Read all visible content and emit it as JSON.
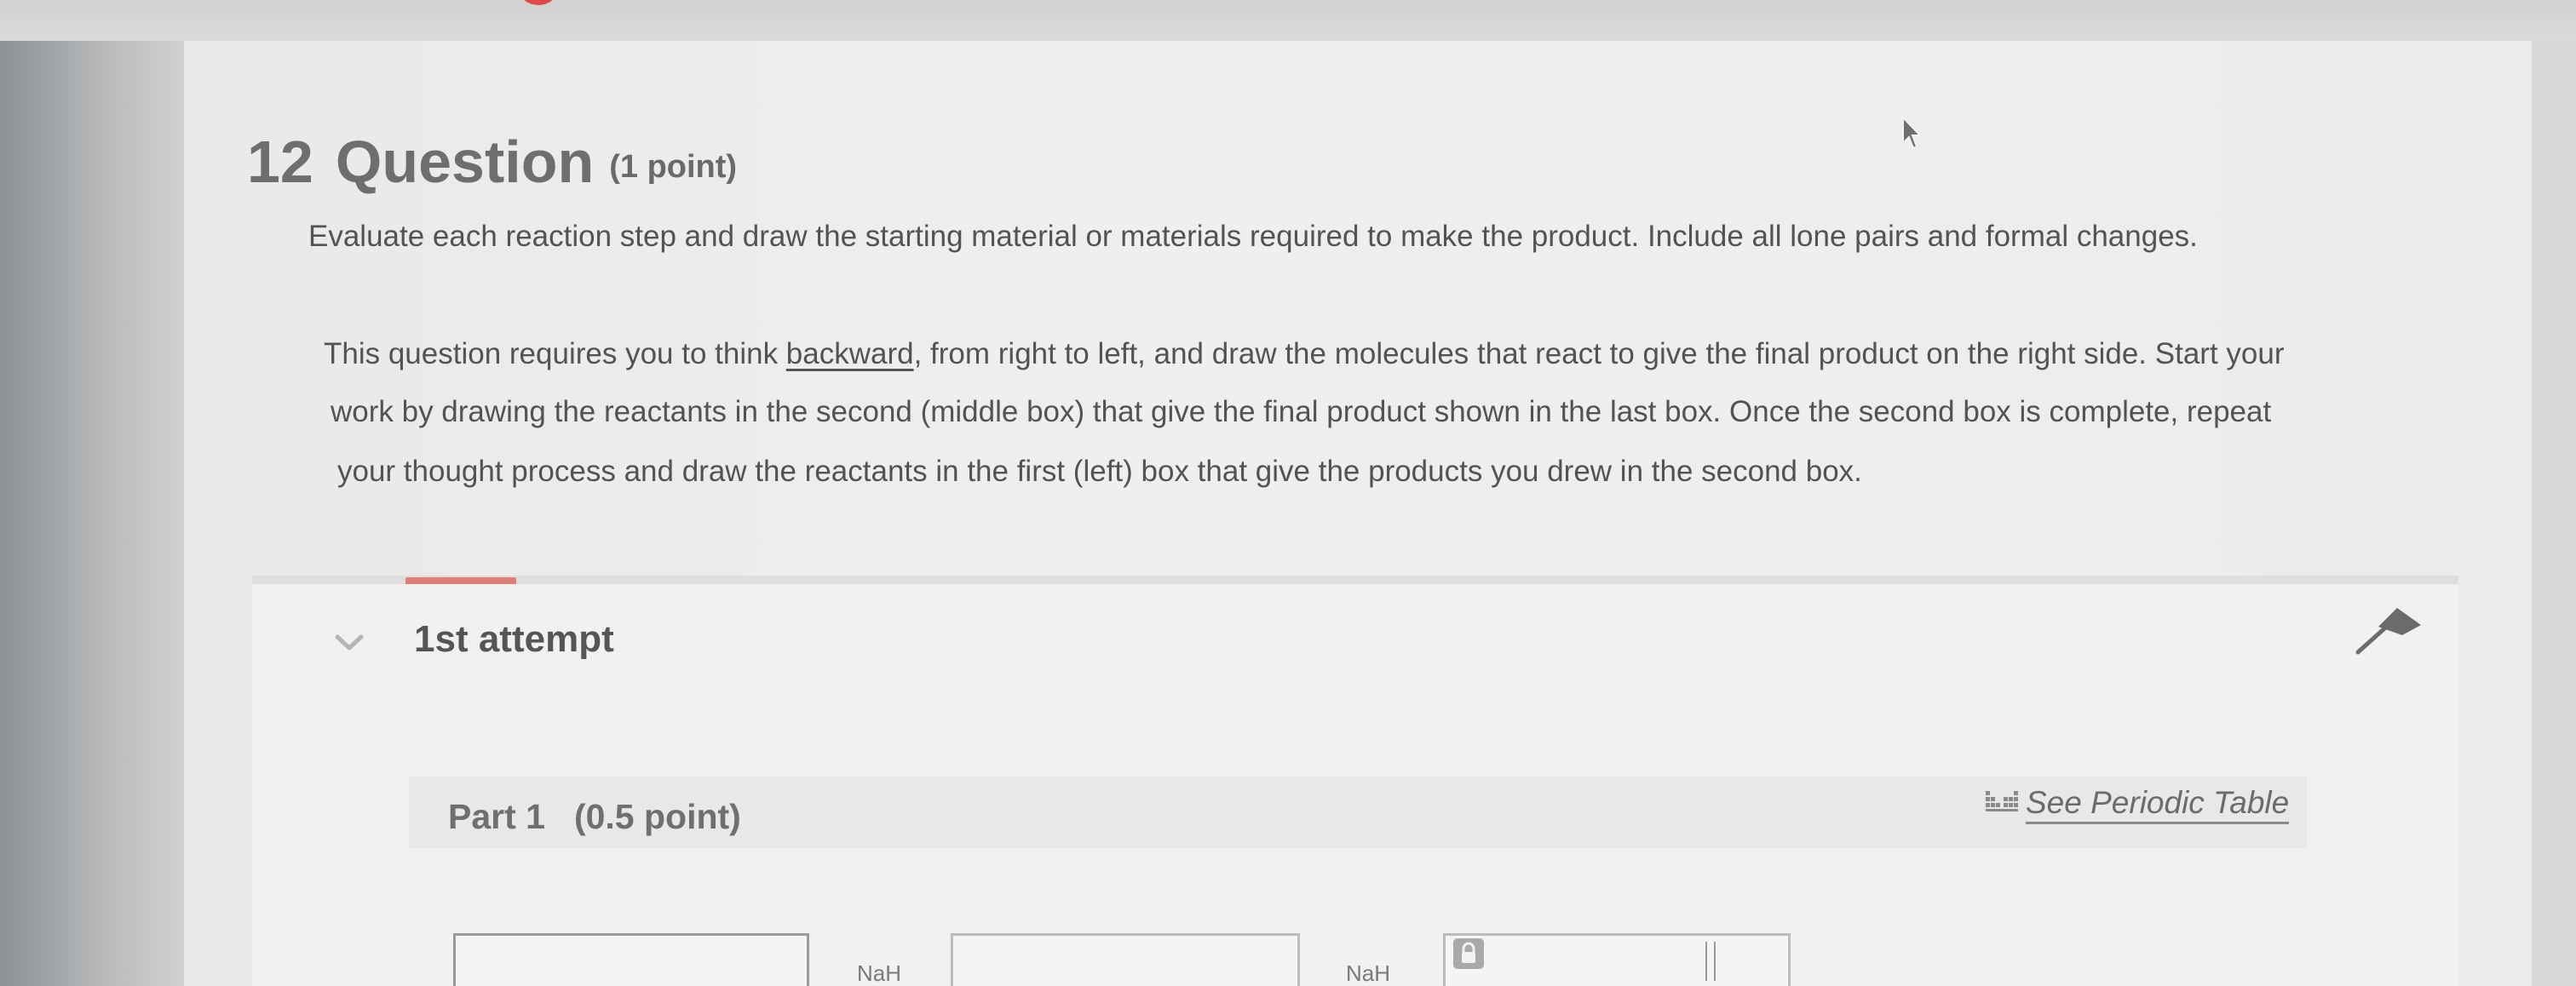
{
  "question": {
    "number": "12",
    "title": "Question",
    "points": "(1 point)",
    "instruction": "Evaluate each reaction step and draw the starting material or materials required to make the product. Include all lone pairs and formal changes.",
    "description": {
      "line1_pre": "This question requires you to think ",
      "line1_emph": "backward",
      "line1_post": ", from right to left, and draw the molecules that react to give the final product on the right side. Start your",
      "line2": "work by drawing the reactants in the second (middle box) that give the final product shown in the last box. Once the second box is complete, repeat",
      "line3": "your thought process and draw the reactants in the first (left) box that give the products you drew in the second box."
    }
  },
  "progress": {
    "fraction": 0.05
  },
  "attempt": {
    "label": "1st attempt"
  },
  "part": {
    "label": "Part 1",
    "points": "(0.5 point)",
    "periodic_table_link": "See Periodic Table"
  },
  "reaction": {
    "reagent_1": "NaH",
    "reagent_2": "NaH"
  },
  "icons": {
    "chevron": "chevron-down-icon",
    "pin": "pin-icon",
    "periodic": "periodic-table-icon",
    "lock": "lock-icon",
    "cursor": "mouse-cursor-icon"
  },
  "colors": {
    "progress_fill": "#e07f77",
    "text_primary": "#535353",
    "panel_background": "#efefee"
  }
}
